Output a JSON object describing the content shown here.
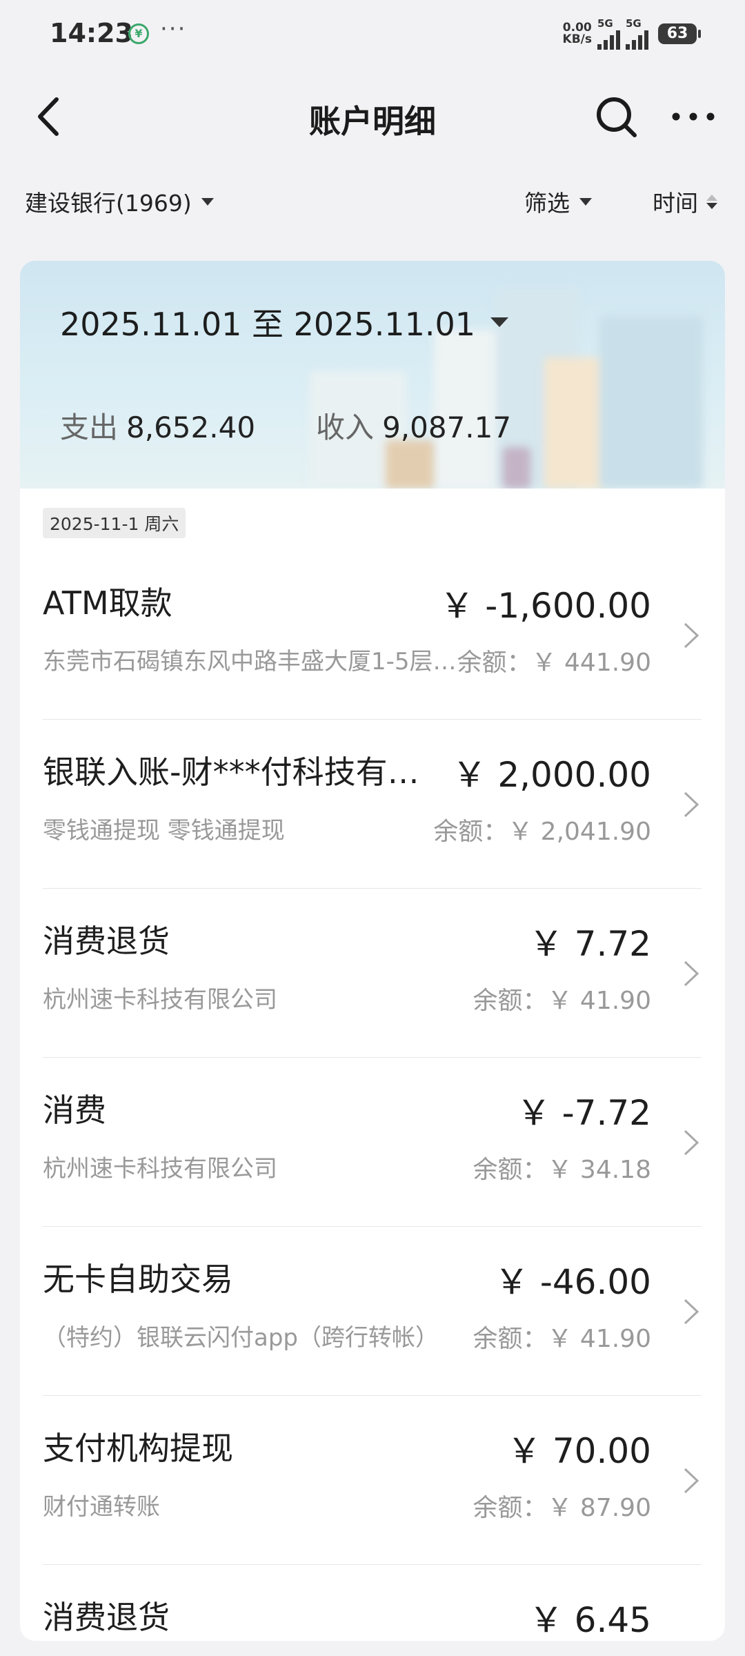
{
  "status_bar": {
    "time": "14:23",
    "dots": "···",
    "net_speed_value": "0.00",
    "net_speed_unit": "KB/s",
    "signal1_label": "5G",
    "signal2_label": "5G",
    "battery": "63",
    "app_icon": "wallet-app-notification-icon"
  },
  "header": {
    "title": "账户明细",
    "back_icon": "back-arrow-icon",
    "search_icon": "search-icon",
    "more_icon": "more-dots-icon"
  },
  "filters": {
    "bank": "建设银行(1969)",
    "filter": "筛选",
    "time": "时间"
  },
  "summary": {
    "date_range": "2025.11.01 至 2025.11.01",
    "expense_label": "支出",
    "expense_value": "8,652.40",
    "income_label": "收入",
    "income_value": "9,087.17"
  },
  "date_group": "2025-11-1 周六",
  "transactions": [
    {
      "title": "ATM取款",
      "amount": "￥ -1,600.00",
      "sub": "东莞市石碣镇东风中路丰盛大厦1-5层…",
      "balance": "余额：￥ 441.90"
    },
    {
      "title": "银联入账-财***付科技有限…",
      "amount": "￥ 2,000.00",
      "sub": "零钱通提现 零钱通提现",
      "balance": "余额：￥ 2,041.90"
    },
    {
      "title": "消费退货",
      "amount": "￥ 7.72",
      "sub": "杭州速卡科技有限公司",
      "balance": "余额：￥ 41.90"
    },
    {
      "title": "消费",
      "amount": "￥ -7.72",
      "sub": "杭州速卡科技有限公司",
      "balance": "余额：￥ 34.18"
    },
    {
      "title": "无卡自助交易",
      "amount": "￥ -46.00",
      "sub": "（特约）银联云闪付app（跨行转帐）",
      "balance": "余额：￥ 41.90"
    },
    {
      "title": "支付机构提现",
      "amount": "￥ 70.00",
      "sub": "财付通转账",
      "balance": "余额：￥ 87.90"
    },
    {
      "title": "消费退货",
      "amount": "￥ 6.45",
      "sub": "",
      "balance": ""
    }
  ]
}
